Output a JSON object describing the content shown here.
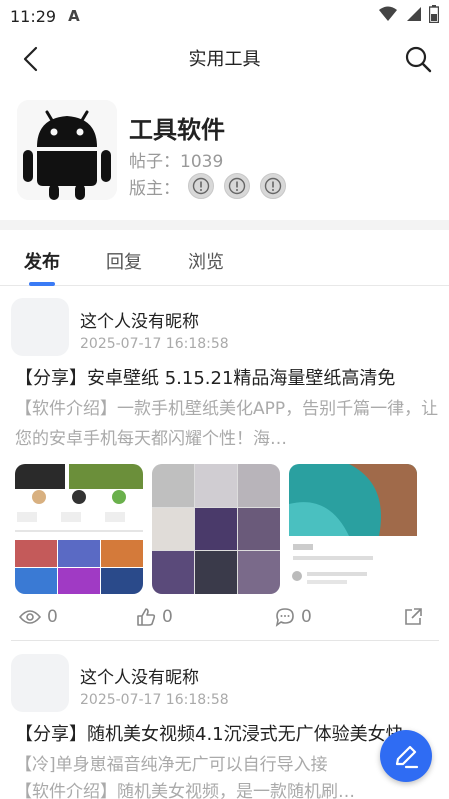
{
  "status_bar": {
    "time": "11:29",
    "app_glyph": "A"
  },
  "app_bar": {
    "title": "实用工具"
  },
  "forum": {
    "name": "工具软件",
    "posts_text": "帖子：1039",
    "moderators_label": "版主："
  },
  "tabs": [
    {
      "label": "发布",
      "active": true
    },
    {
      "label": "回复",
      "active": false
    },
    {
      "label": "浏览",
      "active": false
    }
  ],
  "posts": [
    {
      "author": "这个人没有昵称",
      "time": "2025-07-17 16:18:58",
      "title": "【分享】安卓壁纸 5.15.21精品海量壁纸高清免",
      "excerpt": "【软件介绍】一款手机壁纸美化APP，告别千篇一律，让您的安卓手机每天都闪耀个性！海…",
      "views": "0",
      "likes": "0",
      "comments": "0"
    },
    {
      "author": "这个人没有昵称",
      "time": "2025-07-17 16:18:58",
      "title": "【分享】随机美女视频4.1沉浸式无广体验美女快",
      "excerpt_line1": "【冷]单身崽福音纯净无广可以自行导入接",
      "excerpt_line2": "【软件介绍】随机美女视频，是一款随机刷…"
    }
  ],
  "colors": {
    "accent": "#3a7bf5",
    "fab": "#2f6cf3"
  }
}
